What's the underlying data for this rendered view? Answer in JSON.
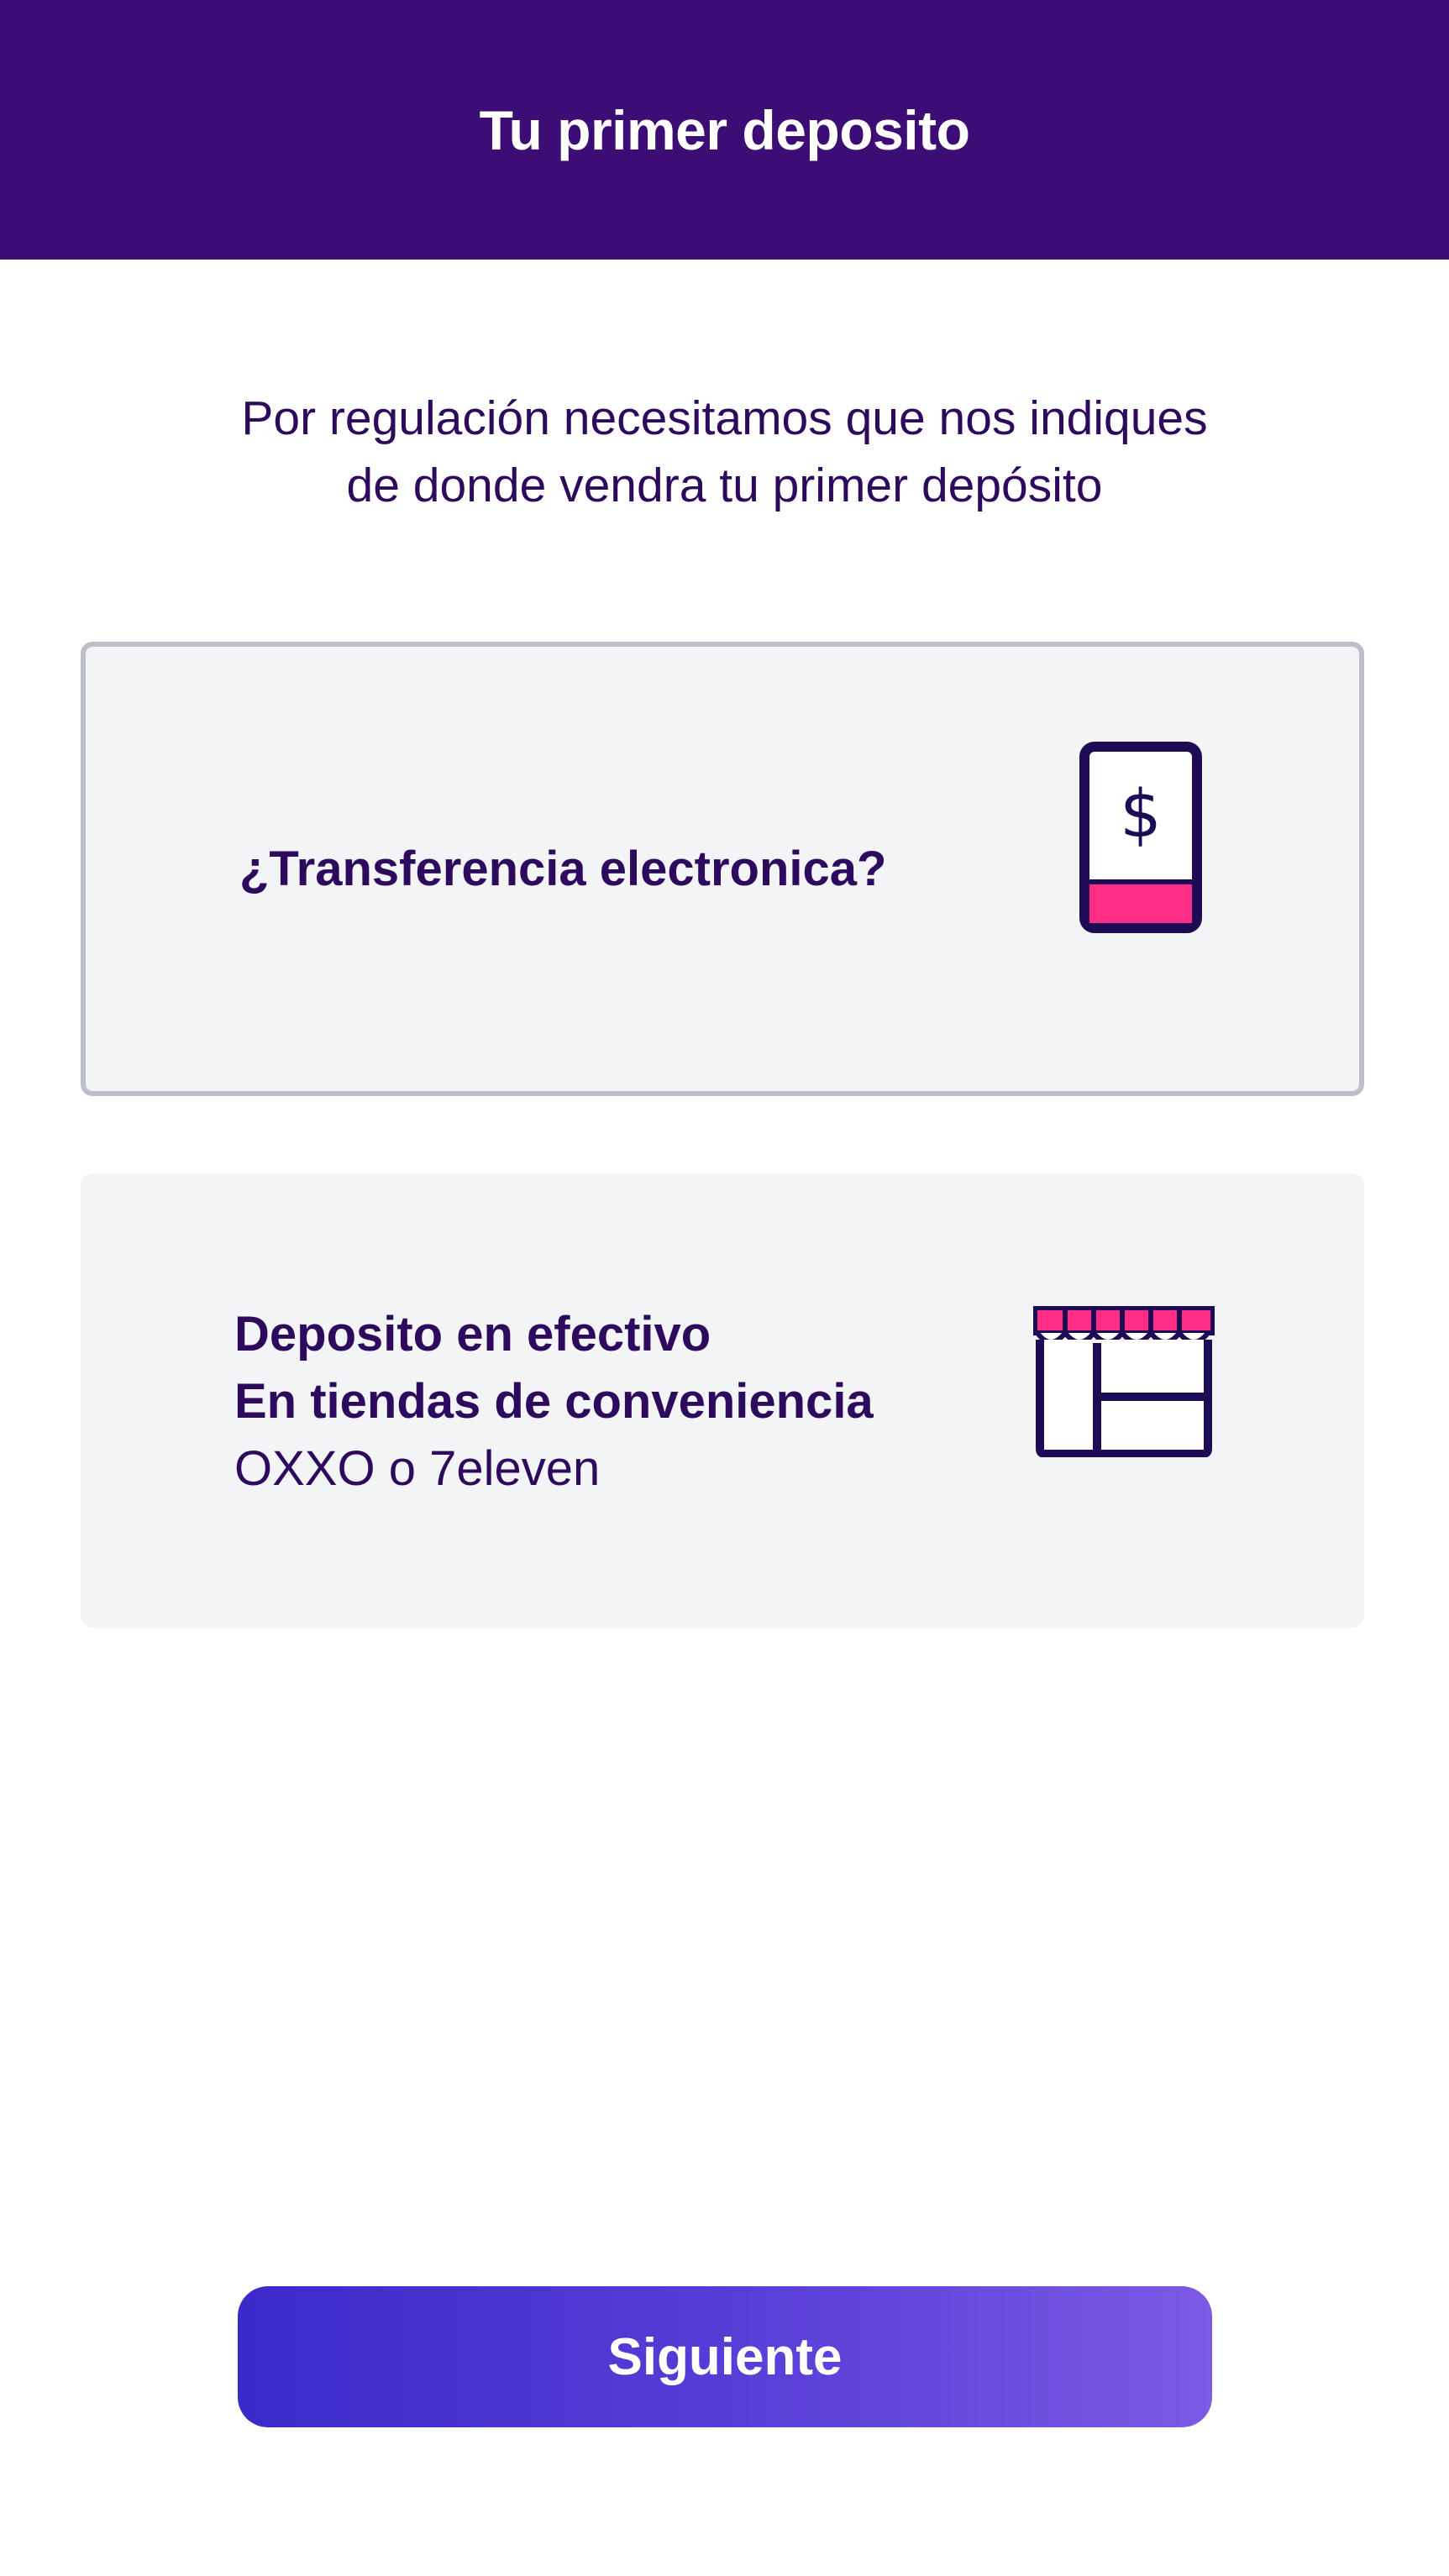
{
  "header": {
    "title": "Tu primer deposito",
    "background_color": "#3c0d75"
  },
  "intro": {
    "line1": "Por regulación necesitamos que nos indiques",
    "line2": "de donde vendra tu primer depósito"
  },
  "options": [
    {
      "label": "¿Transferencia electronica?",
      "icon": "phone-dollar-icon",
      "selected": true
    },
    {
      "title": "Deposito en efectivo",
      "subtitle": "En tiendas de conveniencia",
      "detail": "OXXO o 7eleven",
      "icon": "store-icon",
      "selected": false
    }
  ],
  "cta": {
    "label": "Siguiente"
  },
  "colors": {
    "primary_text": "#2e0a5e",
    "accent_pink": "#ff2d86",
    "card_bg": "#f3f4f6",
    "card_border_selected": "#bcbec8"
  }
}
